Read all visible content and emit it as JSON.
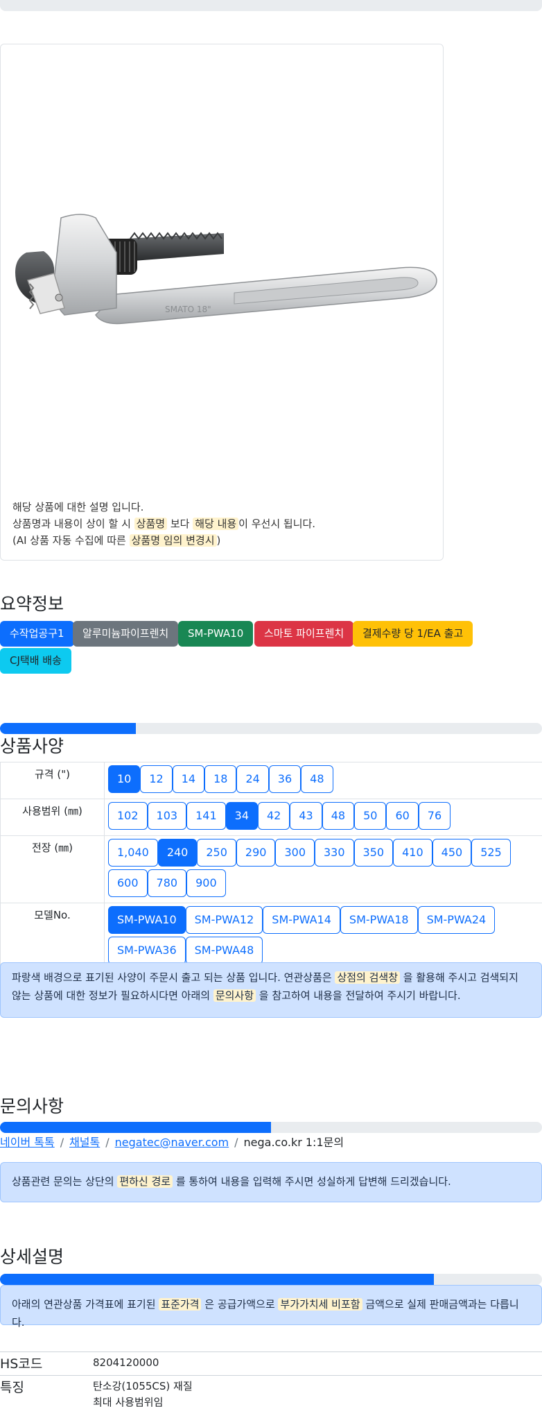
{
  "product_description": {
    "line1": "해당 상품에 대한 설명 입니다.",
    "line2_pre": "상품명과 내용이 상이 할 시 ",
    "line2_hl1": "상품명",
    "line2_mid": " 보다 ",
    "line2_hl2": "해당 내용",
    "line2_post": "이 우선시 됩니다.",
    "line3_pre": "(AI 상품 자동 수집에 따른 ",
    "line3_hl": "상품명 임의 변경시",
    "line3_post": ")"
  },
  "summary": {
    "title": "요약정보",
    "badges": [
      {
        "label": "수작업공구1",
        "color": "#0d6efd"
      },
      {
        "label": "알루미늄파이프렌치",
        "color": "#6c757d"
      },
      {
        "label": "SM-PWA10",
        "color": "#198754"
      },
      {
        "label": "스마토 파이프렌치",
        "color": "#dc3545"
      },
      {
        "label": "결제수량 당 1/EA 출고",
        "color": "#ffc107"
      },
      {
        "label": "CJ택배 배송",
        "color": "#0dcaf0"
      }
    ]
  },
  "specs": {
    "title": "상품사양",
    "progress": 0.25,
    "rows": [
      {
        "label": "규격 (\")",
        "options": [
          "10",
          "12",
          "14",
          "18",
          "24",
          "36",
          "48"
        ],
        "selected": "10"
      },
      {
        "label": "사용범위 (㎜)",
        "options": [
          "102",
          "103",
          "141",
          "34",
          "42",
          "43",
          "48",
          "50",
          "60",
          "76"
        ],
        "selected": "34"
      },
      {
        "label": "전장 (㎜)",
        "options": [
          "1,040",
          "240",
          "250",
          "290",
          "300",
          "330",
          "350",
          "410",
          "450",
          "525",
          "600",
          "780",
          "900"
        ],
        "selected": "240"
      },
      {
        "label": "모델No.",
        "options": [
          "SM-PWA10",
          "SM-PWA12",
          "SM-PWA14",
          "SM-PWA18",
          "SM-PWA24",
          "SM-PWA36",
          "SM-PWA48"
        ],
        "selected": "SM-PWA10"
      }
    ],
    "notice_pre": "파랑색 배경으로 표기된 사양이 주문시 출고 되는 상품 입니다. 연관상품은 ",
    "notice_hl1": "상점의 검색창",
    "notice_mid": " 을 활용해 주시고 검색되지 않는 상품에 대한 정보가 필요하시다면 아래의 ",
    "notice_hl2": "문의사항",
    "notice_post": " 을 참고하여 내용을 전달하여 주시기 바랍니다."
  },
  "inquiry": {
    "title": "문의사항",
    "progress": 0.5,
    "links": [
      "네이버 톡톡",
      "채널톡",
      "negatec@naver.com"
    ],
    "plain": "nega.co.kr 1:1문의",
    "notice_pre": "상품관련 문의는 상단의 ",
    "notice_hl": "편하신 경로",
    "notice_post": " 를 통하여 내용을 입력해 주시면 성실하게 답변해 드리겠습니다."
  },
  "details": {
    "title": "상세설명",
    "progress": 0.8,
    "notice_pre": "아래의 연관상품 가격표에 표기된 ",
    "notice_hl1": "표준가격",
    "notice_mid": " 은 공급가액으로 ",
    "notice_hl2": "부가가치세 비포함",
    "notice_post": " 금액으로 실제 판매금액과는 다릅니다.",
    "hs_label": "HS코드",
    "hs_value": "8204120000",
    "feature_label": "특징",
    "feature_line1": "탄소강(1055CS) 재질",
    "feature_line2": "최대 사용범위임"
  },
  "wrench_marking": "SMATO   18\""
}
